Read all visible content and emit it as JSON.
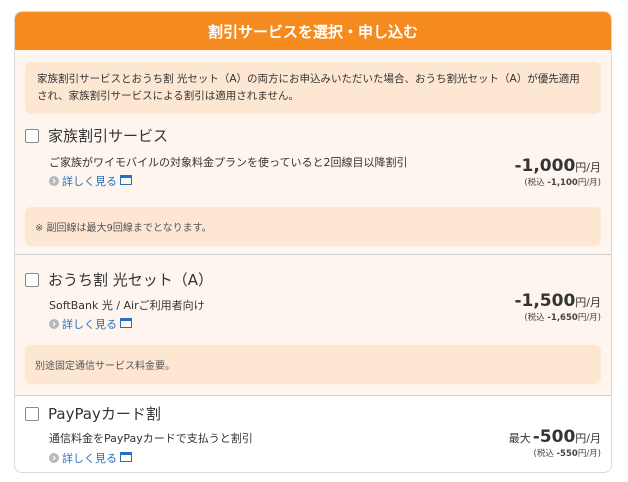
{
  "header": {
    "title": "割引サービスを選択・申し込む"
  },
  "notice": {
    "text": "家族割引サービスとおうち割 光セット（A）の両方にお申込みいただいた場合、おうち割光セット（A）が優先適用され、家族割引サービスによる割引は適用されません。"
  },
  "items": [
    {
      "title": "家族割引サービス",
      "description": "ご家族がワイモバイルの対象料金プランを使っていると2回線目以降割引",
      "detail_link": "詳しく見る",
      "price_prefix": "",
      "price_value": "-1,000",
      "price_unit": "円/月",
      "tax_prefix": "(税込 ",
      "tax_value": "-1,100",
      "tax_suffix": "円/月)",
      "note": "※ 副回線は最大9回線までとなります。"
    },
    {
      "title": "おうち割 光セット（A）",
      "description": "SoftBank 光 / Airご利用者向け",
      "detail_link": "詳しく見る",
      "price_prefix": "",
      "price_value": "-1,500",
      "price_unit": "円/月",
      "tax_prefix": "(税込 ",
      "tax_value": "-1,650",
      "tax_suffix": "円/月)",
      "note": "別途固定通信サービス料金要。"
    },
    {
      "title": "PayPayカード割",
      "description": "通信料金をPayPayカードで支払うと割引",
      "detail_link": "詳しく見る",
      "price_prefix": "最大",
      "price_value": "-500",
      "price_unit": "円/月",
      "tax_prefix": "(税込 ",
      "tax_value": "-550",
      "tax_suffix": "円/月)"
    }
  ],
  "colors": {
    "accent": "#f58a1f",
    "link": "#2a6fbf",
    "note_bg": "#fde7d3",
    "panel_bg": "#fdf5ee"
  },
  "icons": {
    "detail": "arrow-circle-icon",
    "external": "window-icon"
  }
}
